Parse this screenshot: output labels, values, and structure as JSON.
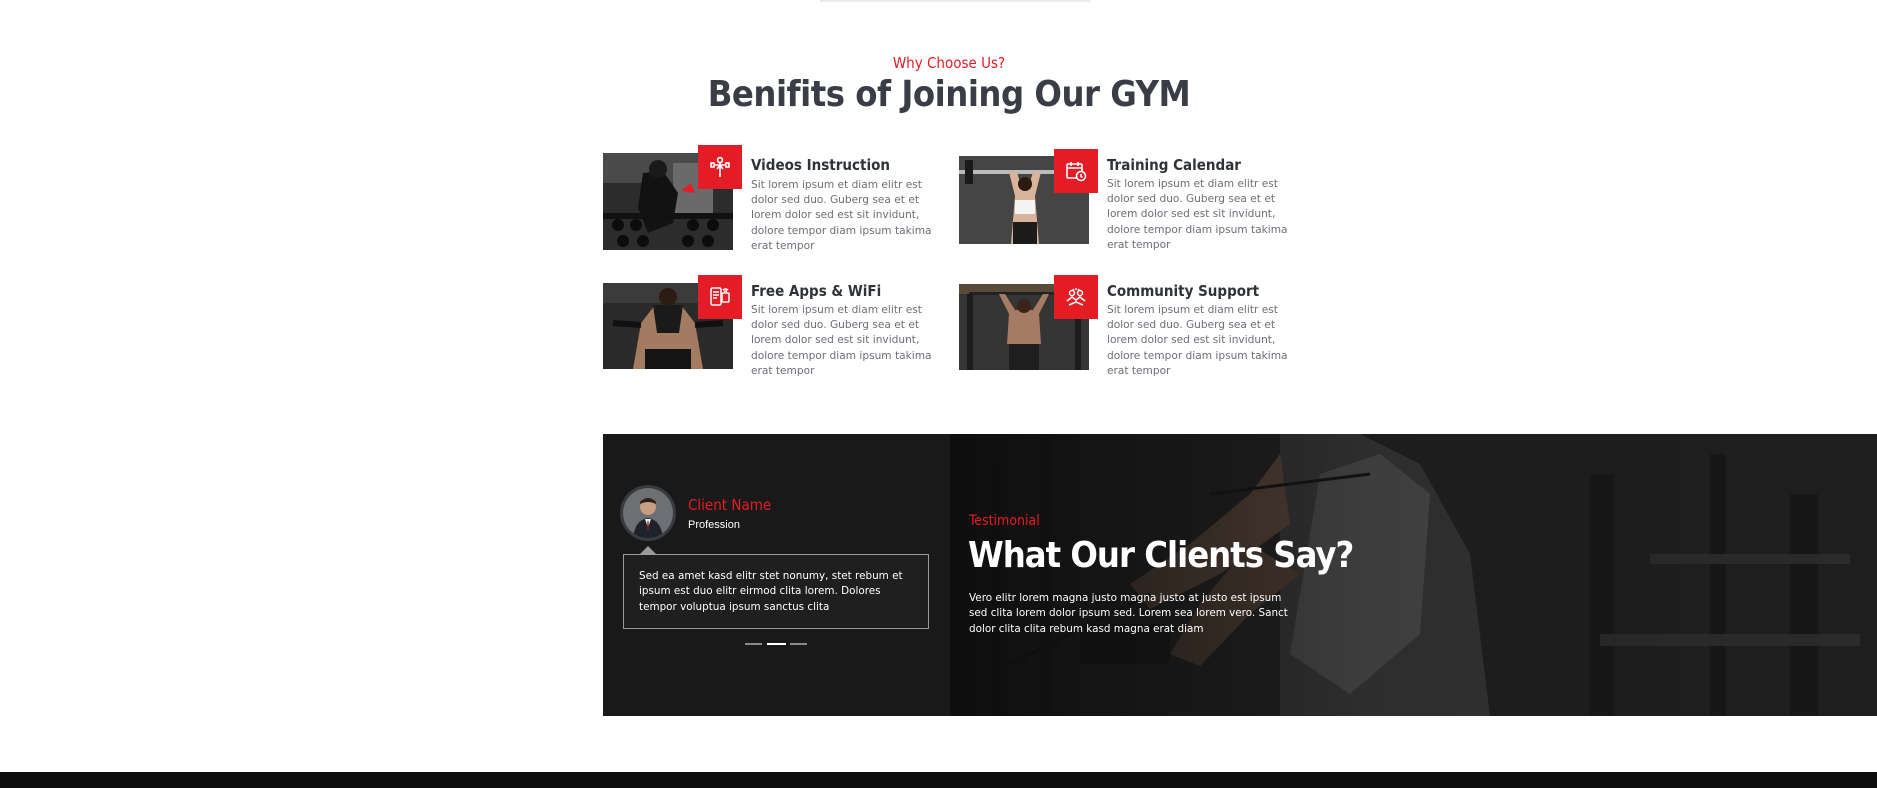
{
  "section": {
    "subtitle": "Why Choose Us?",
    "title": "Benifits of Joining Our GYM"
  },
  "features": [
    {
      "title": "Videos Instruction",
      "icon": "trainer-icon",
      "text": "Sit lorem ipsum et diam elitr est dolor sed duo. Guberg sea et et lorem dolor sed est sit invidunt, dolore tempor diam ipsum takima erat tempor"
    },
    {
      "title": "Training Calendar",
      "icon": "calendar-icon",
      "text": "Sit lorem ipsum et diam elitr est dolor sed duo. Guberg sea et et lorem dolor sed est sit invidunt, dolore tempor diam ipsum takima erat tempor"
    },
    {
      "title": "Free Apps & WiFi",
      "icon": "apps-icon",
      "text": "Sit lorem ipsum et diam elitr est dolor sed duo. Guberg sea et et lorem dolor sed est sit invidunt, dolore tempor diam ipsum takima erat tempor"
    },
    {
      "title": "Community Support",
      "icon": "community-icon",
      "text": "Sit lorem ipsum et diam elitr est dolor sed duo. Guberg sea et et lorem dolor sed est sit invidunt, dolore tempor diam ipsum takima erat tempor"
    }
  ],
  "testimonial": {
    "client_name": "Client Name",
    "profession": "Profession",
    "quote": "Sed ea amet kasd elitr stet nonumy, stet rebum et ipsum est duo elitr eirmod clita lorem. Dolores tempor voluptua ipsum sanctus clita",
    "label": "Testimonial",
    "heading": "What Our Clients Say?",
    "text": "Vero elitr lorem magna justo magna justo at justo est ipsum sed clita lorem dolor ipsum sed. Lorem sea lorem vero. Sanct dolor clita clita rebum kasd magna erat diam",
    "active_slide": 2,
    "slide_count": 3
  },
  "colors": {
    "accent": "#e31c25",
    "heading": "#3a3d46",
    "dark_panel": "#191919"
  }
}
